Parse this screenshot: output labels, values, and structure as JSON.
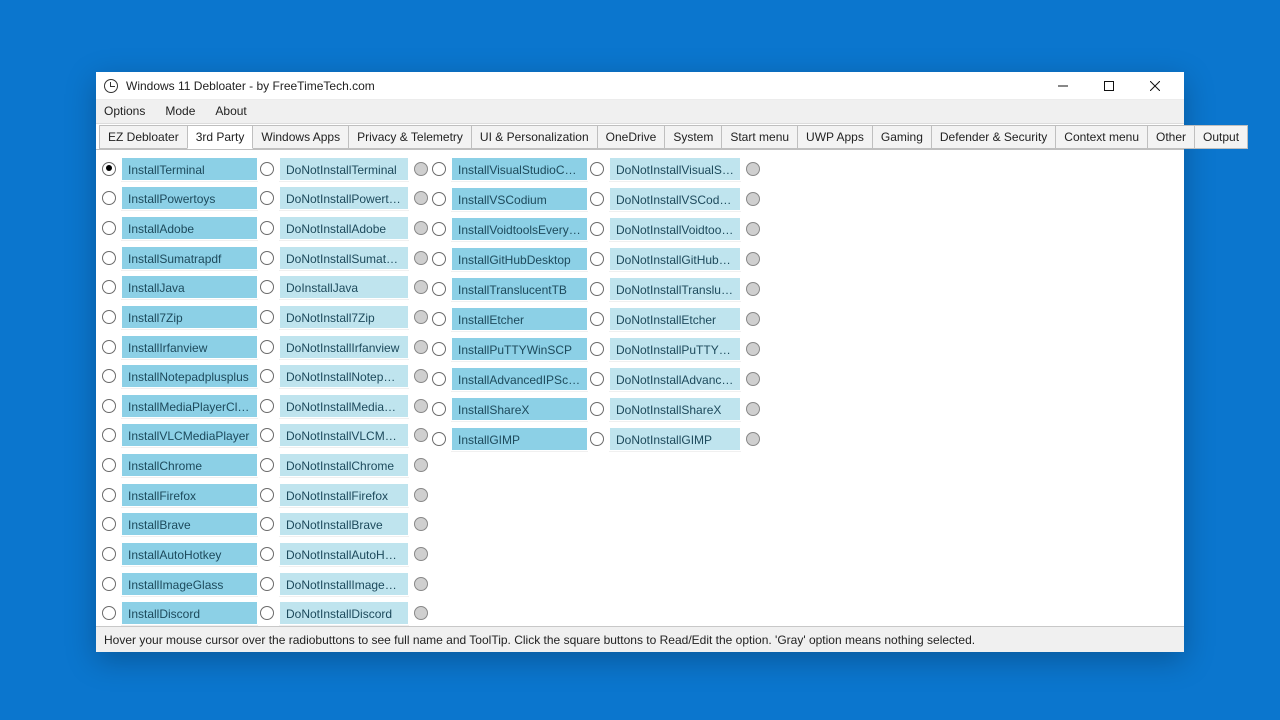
{
  "window": {
    "title": "Windows 11 Debloater - by FreeTimeTech.com"
  },
  "menu": [
    "Options",
    "Mode",
    "About"
  ],
  "tabs": [
    {
      "label": "EZ Debloater",
      "active": false
    },
    {
      "label": "3rd Party",
      "active": true
    },
    {
      "label": "Windows Apps",
      "active": false
    },
    {
      "label": "Privacy & Telemetry",
      "active": false
    },
    {
      "label": "UI & Personalization",
      "active": false
    },
    {
      "label": "OneDrive",
      "active": false
    },
    {
      "label": "System",
      "active": false
    },
    {
      "label": "Start menu",
      "active": false
    },
    {
      "label": "UWP Apps",
      "active": false
    },
    {
      "label": "Gaming",
      "active": false
    },
    {
      "label": "Defender & Security",
      "active": false
    },
    {
      "label": "Context menu",
      "active": false
    },
    {
      "label": "Other",
      "active": false
    },
    {
      "label": "Output",
      "active": false
    }
  ],
  "col1": [
    {
      "label": "InstallTerminal",
      "checked": true
    },
    {
      "label": "InstallPowertoys"
    },
    {
      "label": "InstallAdobe"
    },
    {
      "label": "InstallSumatrapdf"
    },
    {
      "label": "InstallJava"
    },
    {
      "label": "Install7Zip"
    },
    {
      "label": "InstallIrfanview"
    },
    {
      "label": "InstallNotepadplusplus"
    },
    {
      "label": "InstallMediaPlayerClassic"
    },
    {
      "label": "InstallVLCMediaPlayer"
    },
    {
      "label": "InstallChrome"
    },
    {
      "label": "InstallFirefox"
    },
    {
      "label": "InstallBrave"
    },
    {
      "label": "InstallAutoHotkey"
    },
    {
      "label": "InstallImageGlass"
    },
    {
      "label": "InstallDiscord"
    }
  ],
  "col2": [
    {
      "label": "DoNotInstallTerminal"
    },
    {
      "label": "DoNotInstallPowertoys"
    },
    {
      "label": "DoNotInstallAdobe"
    },
    {
      "label": "DoNotInstallSumatrapdf"
    },
    {
      "label": "DoInstallJava"
    },
    {
      "label": "DoNotInstall7Zip"
    },
    {
      "label": "DoNotInstallIrfanview"
    },
    {
      "label": "DoNotInstallNotepadplusplus"
    },
    {
      "label": "DoNotInstallMediaPlayerClassic"
    },
    {
      "label": "DoNotInstallVLCMediaPlayer"
    },
    {
      "label": "DoNotInstallChrome"
    },
    {
      "label": "DoNotInstallFirefox"
    },
    {
      "label": "DoNotInstallBrave"
    },
    {
      "label": "DoNotInstallAutoHotkey"
    },
    {
      "label": "DoNotInstallImageGlass"
    },
    {
      "label": "DoNotInstallDiscord"
    }
  ],
  "col3": [
    {
      "label": "InstallVisualStudioCode"
    },
    {
      "label": "InstallVSCodium"
    },
    {
      "label": "InstallVoidtoolsEverything"
    },
    {
      "label": "InstallGitHubDesktop"
    },
    {
      "label": "InstallTranslucentTB"
    },
    {
      "label": "InstallEtcher"
    },
    {
      "label": "InstallPuTTYWinSCP"
    },
    {
      "label": "InstallAdvancedIPScanner"
    },
    {
      "label": "InstallShareX"
    },
    {
      "label": "InstallGIMP"
    }
  ],
  "col4": [
    {
      "label": "DoNotInstallVisualStudioCode"
    },
    {
      "label": "DoNotInstallVSCodium"
    },
    {
      "label": "DoNotInstallVoidtoolsEverything"
    },
    {
      "label": "DoNotInstallGitHubDesktop"
    },
    {
      "label": "DoNotInstallTranslucentTB"
    },
    {
      "label": "DoNotInstallEtcher"
    },
    {
      "label": "DoNotInstallPuTTYWinSCP"
    },
    {
      "label": "DoNotInstallAdvancedIPScanner"
    },
    {
      "label": "DoNotInstallShareX"
    },
    {
      "label": "DoNotInstallGIMP"
    }
  ],
  "status": "Hover your mouse cursor over the radiobuttons to see full name and ToolTip. Click the square buttons to Read/Edit the option. 'Gray' option means nothing selected."
}
